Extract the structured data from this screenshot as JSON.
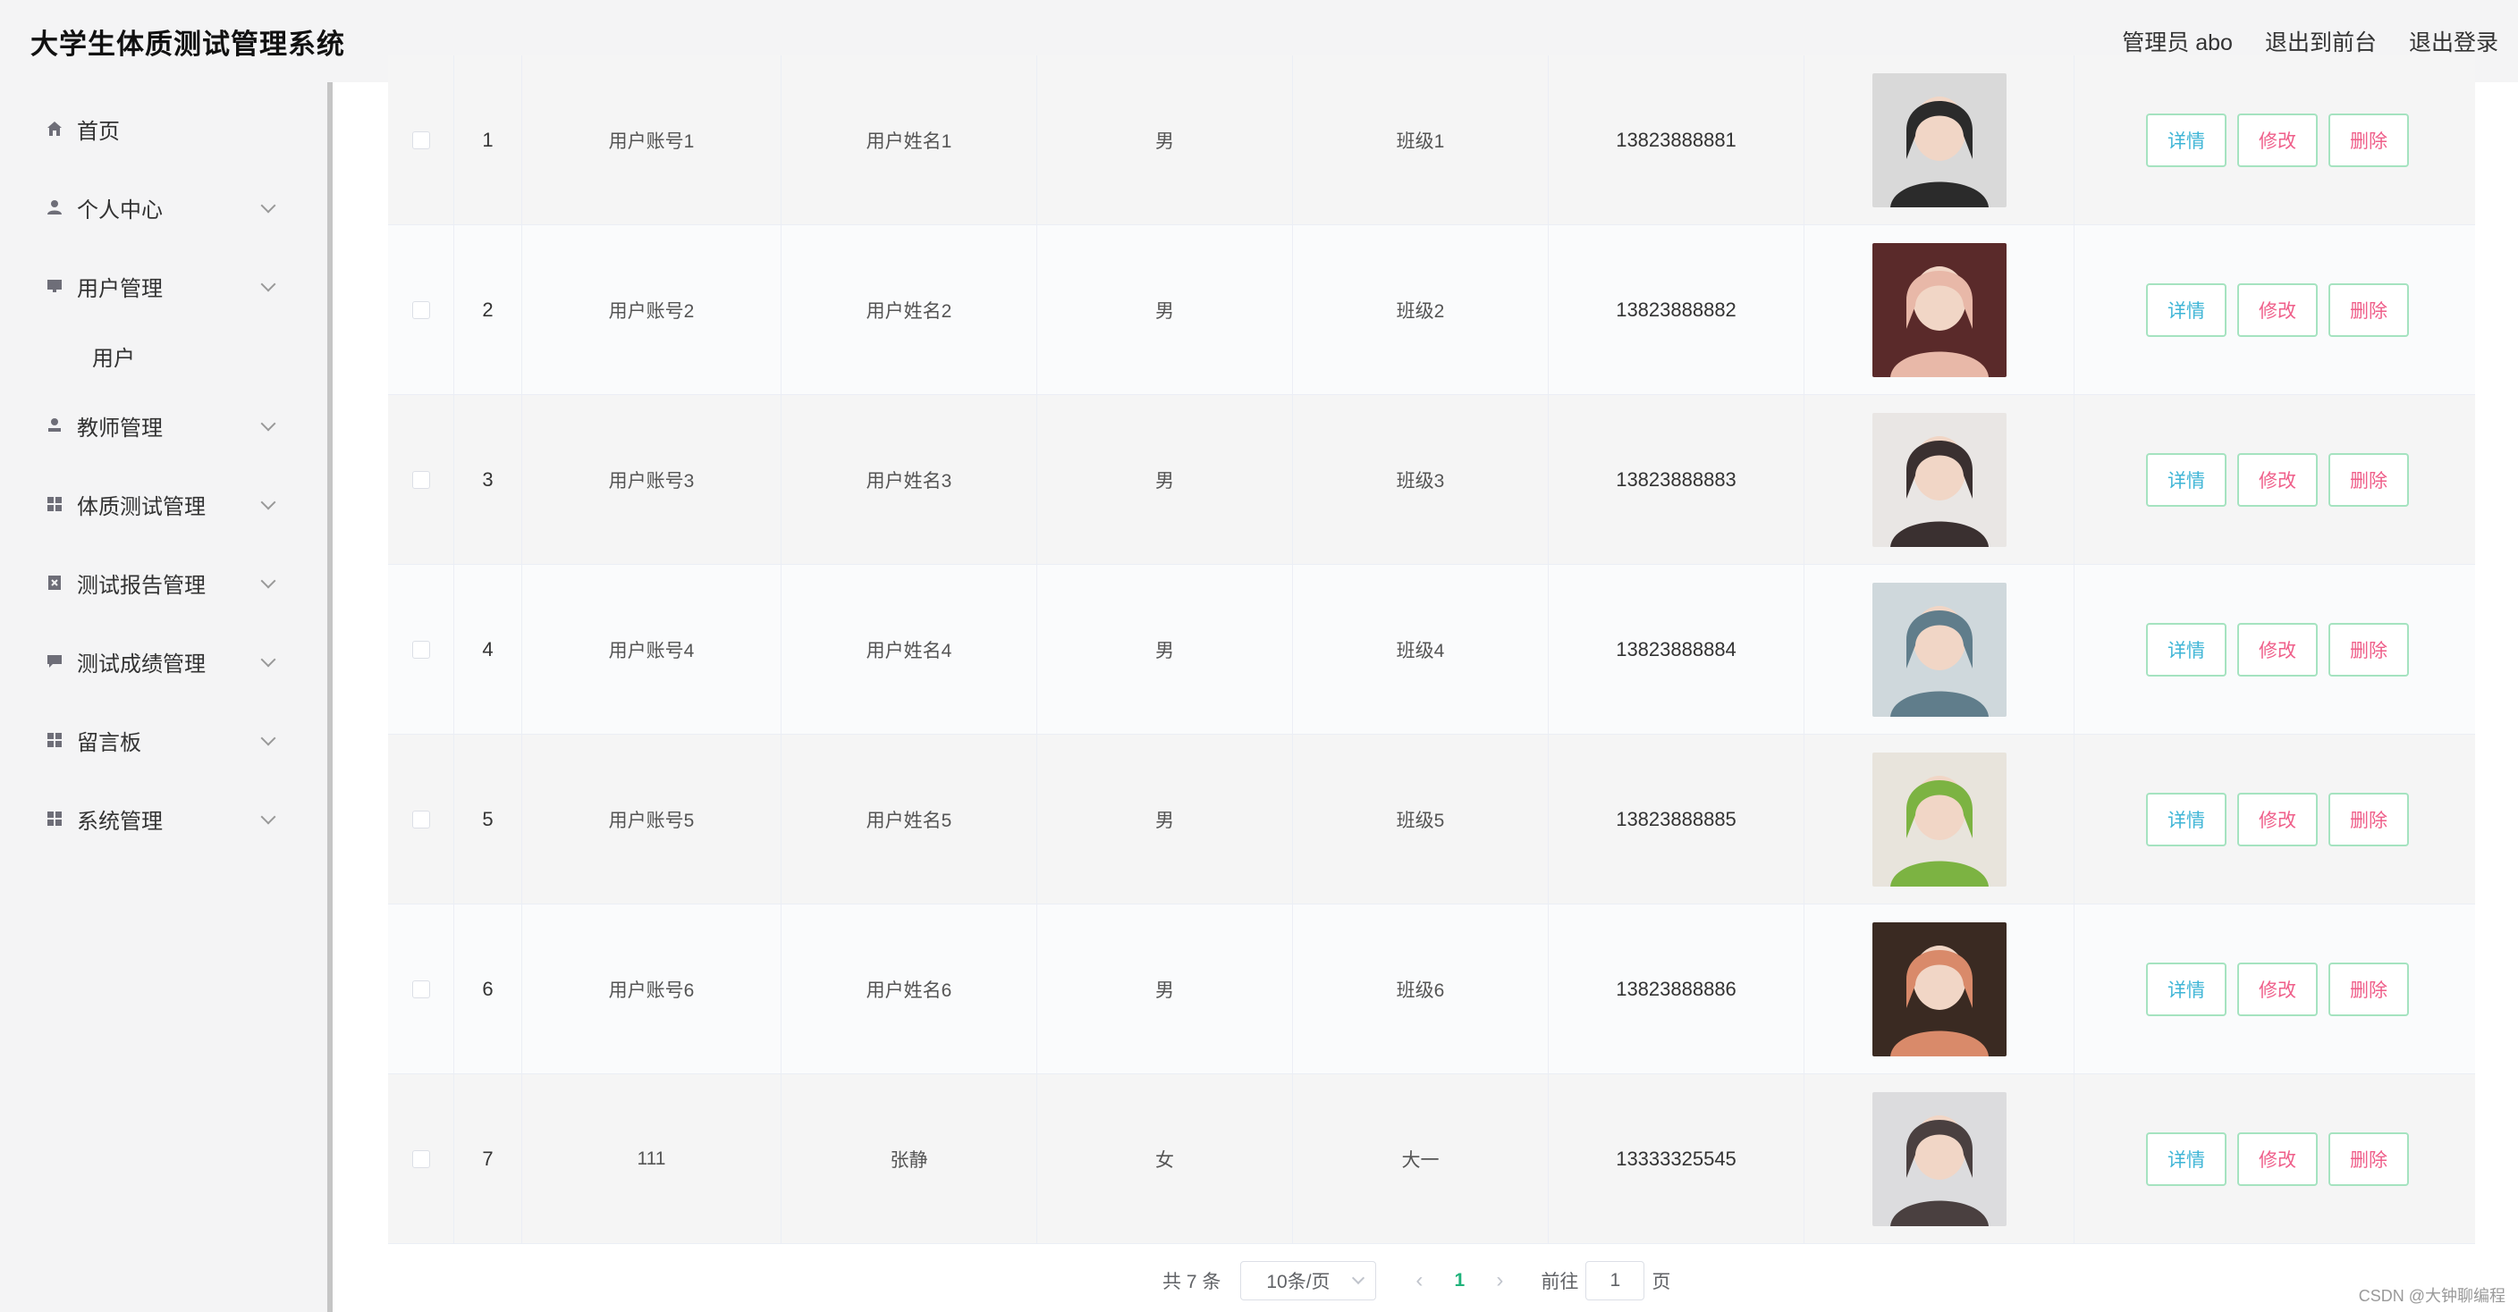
{
  "header": {
    "title": "大学生体质测试管理系统",
    "admin_label": "管理员 abo",
    "front_label": "退出到前台",
    "logout_label": "退出登录"
  },
  "sidebar": {
    "items": [
      {
        "label": "首页",
        "icon": "home-icon",
        "has_children": false
      },
      {
        "label": "个人中心",
        "icon": "user-icon",
        "has_children": true
      },
      {
        "label": "用户管理",
        "icon": "monitor-icon",
        "has_children": true
      },
      {
        "label": "教师管理",
        "icon": "teacher-icon",
        "has_children": true
      },
      {
        "label": "体质测试管理",
        "icon": "grid-icon",
        "has_children": true
      },
      {
        "label": "测试报告管理",
        "icon": "report-icon",
        "has_children": true
      },
      {
        "label": "测试成绩管理",
        "icon": "chat-icon",
        "has_children": true
      },
      {
        "label": "留言板",
        "icon": "grid-icon",
        "has_children": true
      },
      {
        "label": "系统管理",
        "icon": "grid-icon",
        "has_children": true
      }
    ],
    "subitem": {
      "label": "用户"
    }
  },
  "table": {
    "rows": [
      {
        "index": "1",
        "account": "用户账号1",
        "name": "用户姓名1",
        "gender": "男",
        "class": "班级1",
        "phone": "13823888881",
        "photo_colors": [
          "#d9d9d9",
          "#2b2b2b"
        ]
      },
      {
        "index": "2",
        "account": "用户账号2",
        "name": "用户姓名2",
        "gender": "男",
        "class": "班级2",
        "phone": "13823888882",
        "photo_colors": [
          "#5a2a2a",
          "#e8b8a8"
        ]
      },
      {
        "index": "3",
        "account": "用户账号3",
        "name": "用户姓名3",
        "gender": "男",
        "class": "班级3",
        "phone": "13823888883",
        "photo_colors": [
          "#e9e6e4",
          "#3a3030"
        ]
      },
      {
        "index": "4",
        "account": "用户账号4",
        "name": "用户姓名4",
        "gender": "男",
        "class": "班级4",
        "phone": "13823888884",
        "photo_colors": [
          "#cfd8dc",
          "#607d8b"
        ]
      },
      {
        "index": "5",
        "account": "用户账号5",
        "name": "用户姓名5",
        "gender": "男",
        "class": "班级5",
        "phone": "13823888885",
        "photo_colors": [
          "#e8e4dc",
          "#7cb342"
        ]
      },
      {
        "index": "6",
        "account": "用户账号6",
        "name": "用户姓名6",
        "gender": "男",
        "class": "班级6",
        "phone": "13823888886",
        "photo_colors": [
          "#3a2a22",
          "#d98a6a"
        ]
      },
      {
        "index": "7",
        "account": "111",
        "name": "张静",
        "gender": "女",
        "class": "大一",
        "phone": "13333325545",
        "photo_colors": [
          "#dcdcde",
          "#4a4040"
        ]
      }
    ],
    "actions": {
      "detail": "详情",
      "edit": "修改",
      "delete": "删除"
    }
  },
  "pagination": {
    "total_label": "共 7 条",
    "page_size": "10条/页",
    "current_page": "1",
    "goto_prefix": "前往",
    "goto_value": "1",
    "goto_suffix": "页"
  },
  "watermark": "CSDN @大钟聊编程"
}
